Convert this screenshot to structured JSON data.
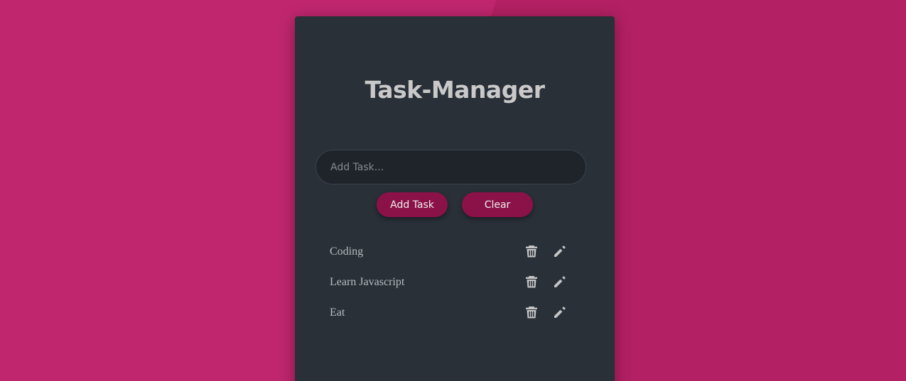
{
  "app": {
    "title": "Task-Manager"
  },
  "input": {
    "placeholder": "Add Task...",
    "value": ""
  },
  "buttons": {
    "add_label": "Add Task",
    "clear_label": "Clear"
  },
  "tasks": [
    {
      "text": "Coding",
      "delete_icon": "trash-icon",
      "edit_icon": "pencil-icon"
    },
    {
      "text": "Learn Javascript",
      "delete_icon": "trash-icon",
      "edit_icon": "pencil-icon"
    },
    {
      "text": "Eat",
      "delete_icon": "trash-icon",
      "edit_icon": "pencil-icon"
    }
  ],
  "colors": {
    "background": "#b32063",
    "card": "#293038",
    "input_bg": "#1f242a",
    "button": "#8b1248",
    "icon": "#c4c4c4"
  }
}
